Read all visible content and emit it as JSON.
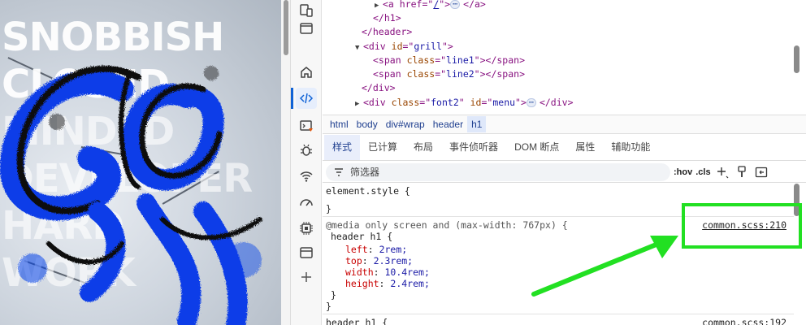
{
  "preview": {
    "words": [
      "SNOBBISH",
      "CLOSED",
      "MINDED",
      "DEVELOPER",
      "HARD",
      "WORK"
    ]
  },
  "dom_tree": {
    "lines": [
      {
        "a_open": "<a href=\"",
        "a_href": "/",
        "a_close": "\">",
        "a_end": "</a>"
      },
      {
        "text": "</h1>"
      },
      {
        "text": "</header>"
      },
      {
        "tag": "<div",
        "attr": "id",
        "val": "grill",
        "end": ">"
      },
      {
        "tag": "<span",
        "attr": "class",
        "val": "line1",
        "end": "></span>"
      },
      {
        "tag": "<span",
        "attr": "class",
        "val": "line2",
        "end": "></span>"
      },
      {
        "text": "</div>"
      },
      {
        "tag": "<div",
        "attr": "class",
        "val": "font2",
        "attr2": "id",
        "val2": "menu",
        "end": ">",
        "end2": "</div>"
      }
    ],
    "ellipsis": "⋯"
  },
  "breadcrumb": [
    "html",
    "body",
    "div#wrap",
    "header",
    "h1"
  ],
  "tabs": [
    "样式",
    "已计算",
    "布局",
    "事件侦听器",
    "DOM 断点",
    "属性",
    "辅助功能"
  ],
  "filter": {
    "placeholder": "筛选器",
    "hov": ":hov",
    "cls": ".cls"
  },
  "styles": {
    "element_style": "element.style {",
    "close_brace": "}",
    "media_query": "@media only screen and (max-width: 767px) {",
    "selector": "header h1 {",
    "properties": [
      {
        "name": "left",
        "value": "2rem;"
      },
      {
        "name": "top",
        "value": "2.3rem;"
      },
      {
        "name": "width",
        "value": "10.4rem;"
      },
      {
        "name": "height",
        "value": "2.4rem;"
      }
    ],
    "inner_close": "}",
    "outer_close": "}",
    "source1": "common.scss:210",
    "next_selector": "header h1 {",
    "source2": "common.scss:192"
  },
  "colors": {
    "highlight_box": "#22e022",
    "arrow": "#22e022",
    "graffiti_blue": "#0a3ee8",
    "accent": "#0f62d6"
  }
}
